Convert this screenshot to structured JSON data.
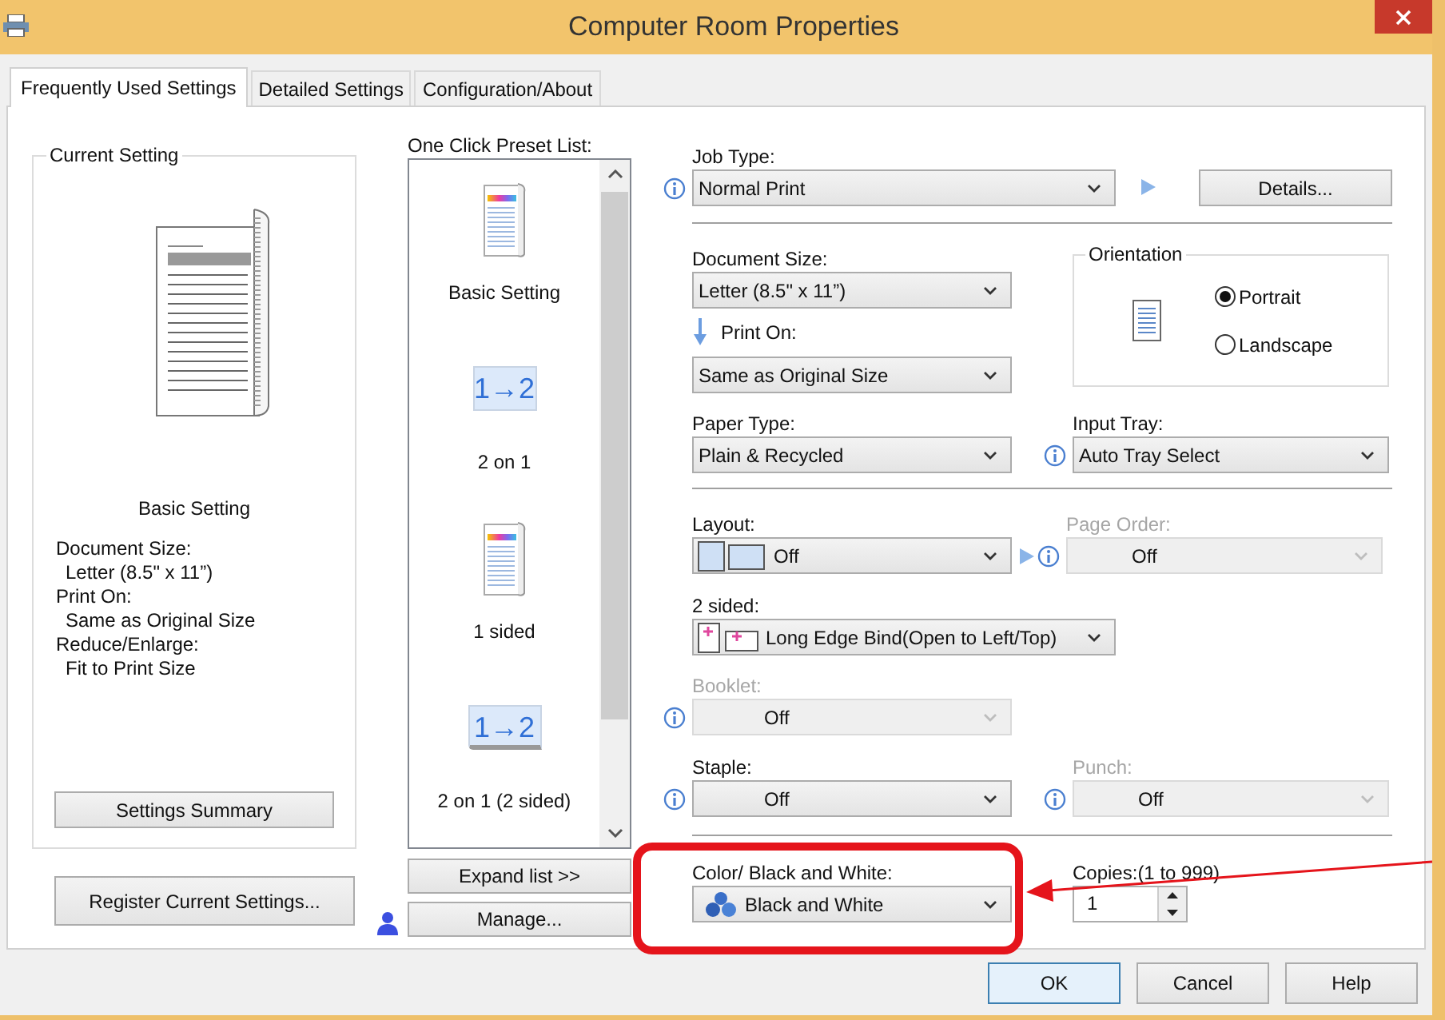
{
  "window": {
    "title": "Computer Room Properties"
  },
  "tabs": [
    {
      "label": "Frequently Used Settings",
      "selected": true
    },
    {
      "label": "Detailed Settings",
      "selected": false
    },
    {
      "label": "Configuration/About",
      "selected": false
    }
  ],
  "current_setting": {
    "title": "Current Setting",
    "preset": "Basic Setting",
    "details": [
      {
        "label": "Document Size:",
        "value": "Letter (8.5\" x 11”)"
      },
      {
        "label": "Print On:",
        "value": "Same as Original Size"
      },
      {
        "label": "Reduce/Enlarge:",
        "value": "Fit to Print Size"
      }
    ],
    "summary_button": "Settings Summary"
  },
  "register_button": "Register Current Settings...",
  "preset_list": {
    "label": "One Click Preset List:",
    "items": [
      {
        "kind": "page",
        "label": "Basic Setting"
      },
      {
        "kind": "combine",
        "icon_text": "1→2",
        "label": "2 on 1"
      },
      {
        "kind": "page",
        "label": "1 sided"
      },
      {
        "kind": "combine_duplex",
        "icon_text": "1→2",
        "label": "2 on 1 (2 sided)"
      }
    ],
    "expand_button": "Expand list >>",
    "manage_button": "Manage..."
  },
  "settings": {
    "job_type": {
      "label": "Job Type:",
      "value": "Normal Print",
      "info": true,
      "disabled": false
    },
    "details_button": "Details...",
    "document_size": {
      "label": "Document Size:",
      "value": "Letter (8.5\" x 11”)",
      "info": false,
      "disabled": false
    },
    "print_on": {
      "label": "Print On:",
      "value": "Same as Original Size",
      "info": false,
      "disabled": false
    },
    "orientation": {
      "title": "Orientation",
      "options": [
        {
          "label": "Portrait",
          "selected": true
        },
        {
          "label": "Landscape",
          "selected": false
        }
      ]
    },
    "paper_type": {
      "label": "Paper Type:",
      "value": "Plain & Recycled",
      "info": false,
      "disabled": false
    },
    "input_tray": {
      "label": "Input Tray:",
      "value": "Auto Tray Select",
      "info": true,
      "disabled": false
    },
    "layout": {
      "label": "Layout:",
      "value": "Off",
      "info": false,
      "disabled": false
    },
    "page_order": {
      "label": "Page Order:",
      "value": "Off",
      "info": true,
      "disabled": true
    },
    "two_sided": {
      "label": "2 sided:",
      "value": "Long Edge Bind(Open to Left/Top)",
      "info": false,
      "disabled": false
    },
    "booklet": {
      "label": "Booklet:",
      "value": "Off",
      "info": true,
      "disabled": true
    },
    "staple": {
      "label": "Staple:",
      "value": "Off",
      "info": true,
      "disabled": false
    },
    "punch": {
      "label": "Punch:",
      "value": "Off",
      "info": true,
      "disabled": true
    },
    "color_mode": {
      "label": "Color/ Black and White:",
      "value": "Black and White",
      "info": false,
      "disabled": false
    },
    "copies": {
      "label": "Copies:(1 to 999)",
      "value": "1"
    }
  },
  "buttons": [
    {
      "label": "OK",
      "default": true
    },
    {
      "label": "Cancel",
      "default": false
    },
    {
      "label": "Help",
      "default": false
    }
  ]
}
